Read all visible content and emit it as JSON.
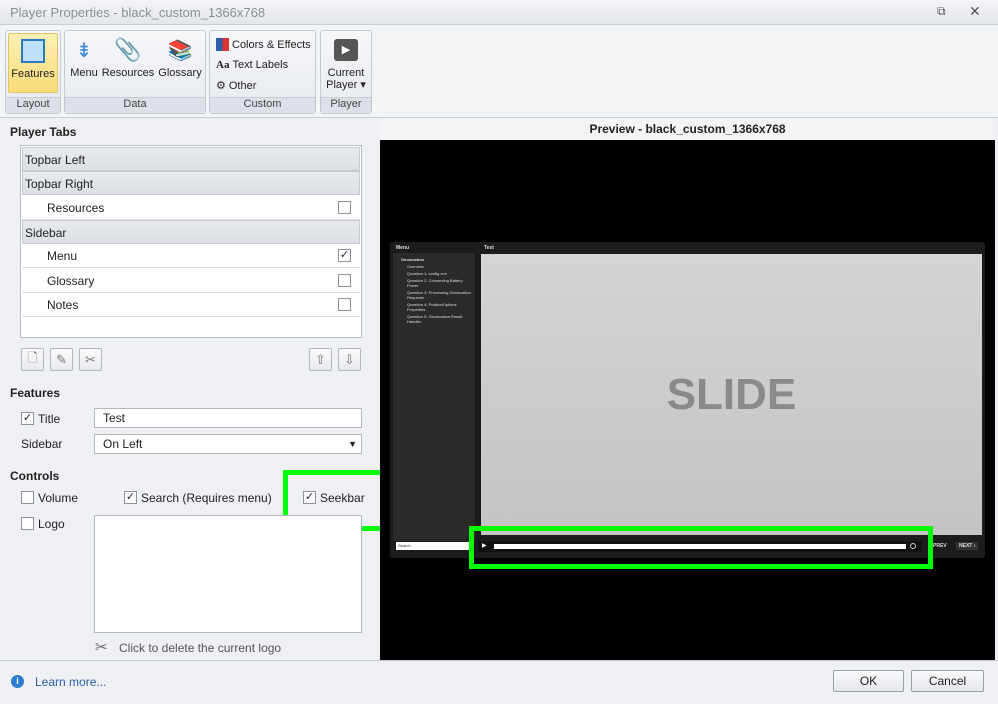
{
  "window": {
    "title": "Player Properties - black_custom_1366x768"
  },
  "ribbon": {
    "groups": [
      {
        "label": "Layout"
      },
      {
        "label": "Data"
      },
      {
        "label": "Custom"
      },
      {
        "label": "Player"
      }
    ],
    "features": "Features",
    "menu": "Menu",
    "resources": "Resources",
    "glossary": "Glossary",
    "colors": "Colors & Effects",
    "text_labels": "Text Labels",
    "other": "Other",
    "current_player_1": "Current",
    "current_player_2": "Player ▾"
  },
  "player_tabs": {
    "heading": "Player Tabs",
    "rows": [
      {
        "label": "Topbar Left"
      },
      {
        "label": "Topbar Right"
      },
      {
        "label": "Resources",
        "checked": false
      },
      {
        "label": "Sidebar"
      },
      {
        "label": "Menu",
        "checked": true
      },
      {
        "label": "Glossary",
        "checked": false
      },
      {
        "label": "Notes",
        "checked": false
      }
    ]
  },
  "features": {
    "heading": "Features",
    "title_label": "Title",
    "title_checked": true,
    "title_value": "Test",
    "sidebar_label": "Sidebar",
    "sidebar_value": "On Left"
  },
  "controls": {
    "heading": "Controls",
    "volume": "Volume",
    "search": "Search (Requires menu)",
    "seekbar": "Seekbar",
    "logo": "Logo",
    "delete_logo": "Click to delete the current logo"
  },
  "preview": {
    "title": "Preview - black_custom_1366x768",
    "menu_header": "Menu",
    "slide_title": "Test",
    "slide_text": "SLIDE",
    "menu_items": [
      "Geolocation",
      "Overview",
      "Question 1: config.xml",
      "Question 2: Conserving Battery Power",
      "Question 3: Processing Geolocation Requests",
      "Question 4: PositionOptions Properties",
      "Question 5: Geolocation Result Handler"
    ],
    "search": "Search",
    "prev": "PREV",
    "next": "NEXT ›"
  },
  "footer": {
    "learn_more": "Learn more...",
    "ok": "OK",
    "cancel": "Cancel"
  },
  "colors": {
    "highlight": "#00ff00"
  }
}
